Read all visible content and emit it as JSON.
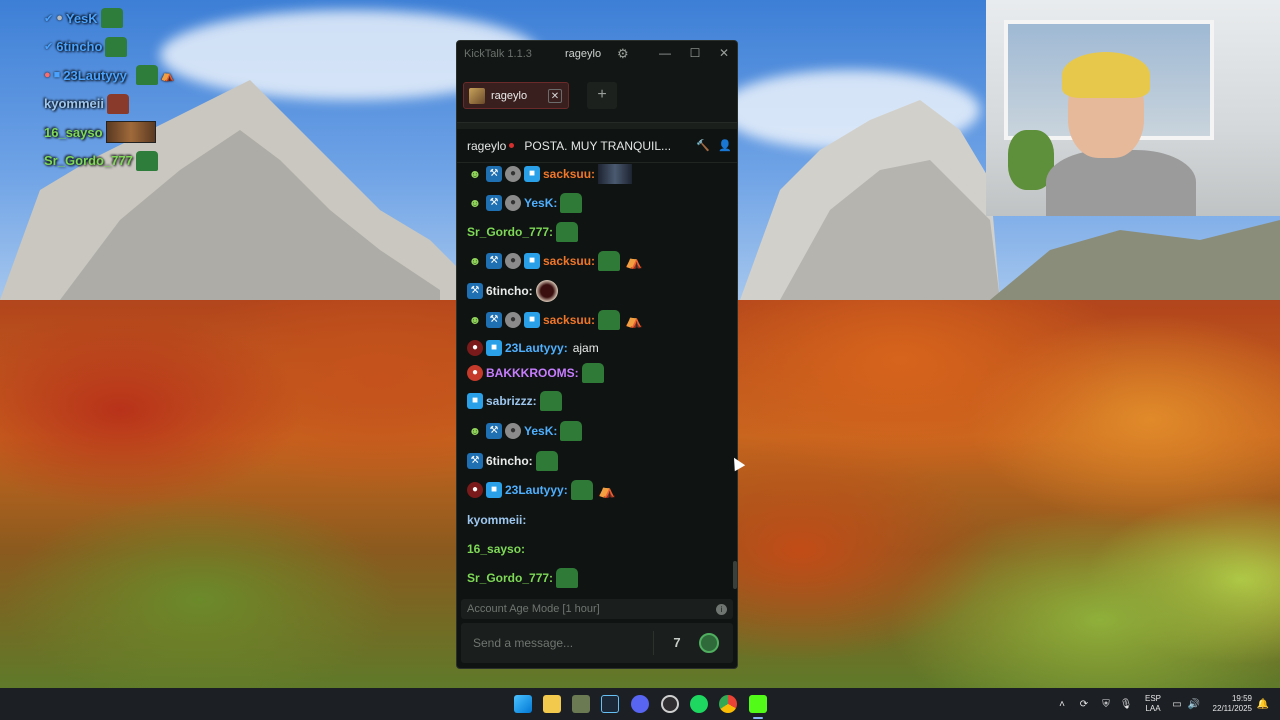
{
  "overlay": {
    "rows": [
      {
        "name": "YesK",
        "color": "#4aa3ff"
      },
      {
        "name": "6tincho",
        "color": "#4aa3ff"
      },
      {
        "name": "23Lautyyy",
        "color": "#4aa3ff"
      },
      {
        "name": "kyommeii",
        "color": "#9ec7f0"
      },
      {
        "name": "16_sayso",
        "color": "#7ed957"
      },
      {
        "name": "Sr_Gordo_777",
        "color": "#7ed957"
      }
    ]
  },
  "kicktalk": {
    "app_title": "KickTalk 1.1.3",
    "username": "rageylo",
    "window_controls": {
      "minimize": "—",
      "maximize": "☐",
      "close": "✕"
    },
    "tab": {
      "label": "rageylo",
      "close": "✕"
    },
    "add_tab": "+",
    "chat_header": {
      "channel": "rageylo",
      "stream_title": "POSTA. MUY TRANQUIL..."
    },
    "messages": [
      {
        "user": "sacksuu:",
        "color": "#f0762a",
        "badges": [
          "og",
          "mod",
          "sub",
          "cube"
        ],
        "emotes": [
          "photo"
        ],
        "text": ""
      },
      {
        "user": "YesK:",
        "color": "#4fb0ff",
        "badges": [
          "og",
          "mod",
          "sub"
        ],
        "emotes": [
          "green"
        ],
        "text": ""
      },
      {
        "user": "Sr_Gordo_777:",
        "color": "#7ed957",
        "badges": [],
        "emotes": [
          "green"
        ],
        "text": ""
      },
      {
        "user": "sacksuu:",
        "color": "#f0762a",
        "badges": [
          "og",
          "mod",
          "sub",
          "cube"
        ],
        "emotes": [
          "green",
          "hat"
        ],
        "text": ""
      },
      {
        "user": "6tincho:",
        "color": "#e8ebe9",
        "badges": [
          "mod"
        ],
        "emotes": [
          "ball"
        ],
        "text": ""
      },
      {
        "user": "sacksuu:",
        "color": "#f0762a",
        "badges": [
          "og",
          "mod",
          "sub",
          "cube"
        ],
        "emotes": [
          "green",
          "hat"
        ],
        "text": ""
      },
      {
        "user": "23Lautyyy:",
        "color": "#4fb0ff",
        "badges": [
          "fang",
          "cube"
        ],
        "emotes": [],
        "text": "ajam"
      },
      {
        "user": "BAKKKROOMS:",
        "color": "#c77dff",
        "badges": [
          "vip"
        ],
        "emotes": [
          "green"
        ],
        "text": ""
      },
      {
        "user": "sabrizzz:",
        "color": "#9ec7f0",
        "badges": [
          "cube"
        ],
        "emotes": [
          "green"
        ],
        "text": ""
      },
      {
        "user": "YesK:",
        "color": "#4fb0ff",
        "badges": [
          "og",
          "mod",
          "sub"
        ],
        "emotes": [
          "green"
        ],
        "text": ""
      },
      {
        "user": "6tincho:",
        "color": "#e8ebe9",
        "badges": [
          "mod"
        ],
        "emotes": [
          "green"
        ],
        "text": ""
      },
      {
        "user": "23Lautyyy:",
        "color": "#4fb0ff",
        "badges": [
          "fang",
          "cube"
        ],
        "emotes": [
          "green",
          "hat"
        ],
        "text": ""
      },
      {
        "user": "kyommeii:",
        "color": "#9ec7f0",
        "badges": [],
        "emotes": [],
        "text": ""
      },
      {
        "user": "16_sayso:",
        "color": "#7ed957",
        "badges": [],
        "emotes": [],
        "text": ""
      },
      {
        "user": "Sr_Gordo_777:",
        "color": "#7ed957",
        "badges": [],
        "emotes": [
          "green"
        ],
        "text": ""
      }
    ],
    "age_mode": "Account Age Mode [1 hour]",
    "input_placeholder": "Send a message..."
  },
  "taskbar": {
    "apps": [
      "windows-start-icon",
      "file-explorer-icon",
      "game-app-icon",
      "steam-icon",
      "discord-icon",
      "obs-icon",
      "spotify-icon",
      "chrome-icon",
      "kick-icon"
    ],
    "language": "ESP",
    "layout": "LAA",
    "time": "19:59",
    "date": "22/11/2025"
  },
  "colors": {
    "kick_green": "#53fc18",
    "mod_badge": "#1f6fb3",
    "cube_badge": "#29a0e8"
  }
}
